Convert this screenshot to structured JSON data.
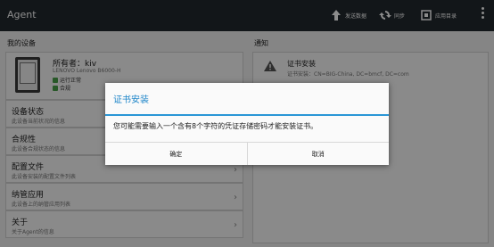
{
  "app": {
    "title": "Agent"
  },
  "actionbar": {
    "actions": [
      {
        "label": "发送数据",
        "icon": "upload-icon"
      },
      {
        "label": "同步",
        "icon": "sync-icon"
      },
      {
        "label": "应用目录",
        "icon": "catalog-icon"
      }
    ],
    "overflow_icon": "more-vert-icon"
  },
  "left": {
    "section_title": "我的设备",
    "device": {
      "owner": "所有者：kiv",
      "model": "LENOVO Lenovo B6000-H",
      "status": [
        "运行正常",
        "合规"
      ],
      "icon": "tablet-icon"
    },
    "rows": [
      {
        "title": "设备状态",
        "subtitle": "此设备当前状况的信息"
      },
      {
        "title": "合规性",
        "subtitle": "此设备合规状态的信息"
      },
      {
        "title": "配置文件",
        "subtitle": "此设备安装的配置文件列表"
      },
      {
        "title": "纳管应用",
        "subtitle": "此设备上的纳管应用列表"
      },
      {
        "title": "关于",
        "subtitle": "关于Agent的信息"
      }
    ]
  },
  "right": {
    "section_title": "通知",
    "notification": {
      "title": "证书安装",
      "subtitle": "证书安装：CN=BIG-China, DC=bmcf, DC=com",
      "icon": "warning-icon"
    }
  },
  "dialog": {
    "title": "证书安装",
    "message": "您可能需要输入一个含有8个字符的凭证存储密码才能安装证书。",
    "ok_label": "确定",
    "cancel_label": "取消"
  },
  "colors": {
    "accent": "#2a96d6",
    "actionbar": "#21282e",
    "status_ok": "#49a04a"
  }
}
